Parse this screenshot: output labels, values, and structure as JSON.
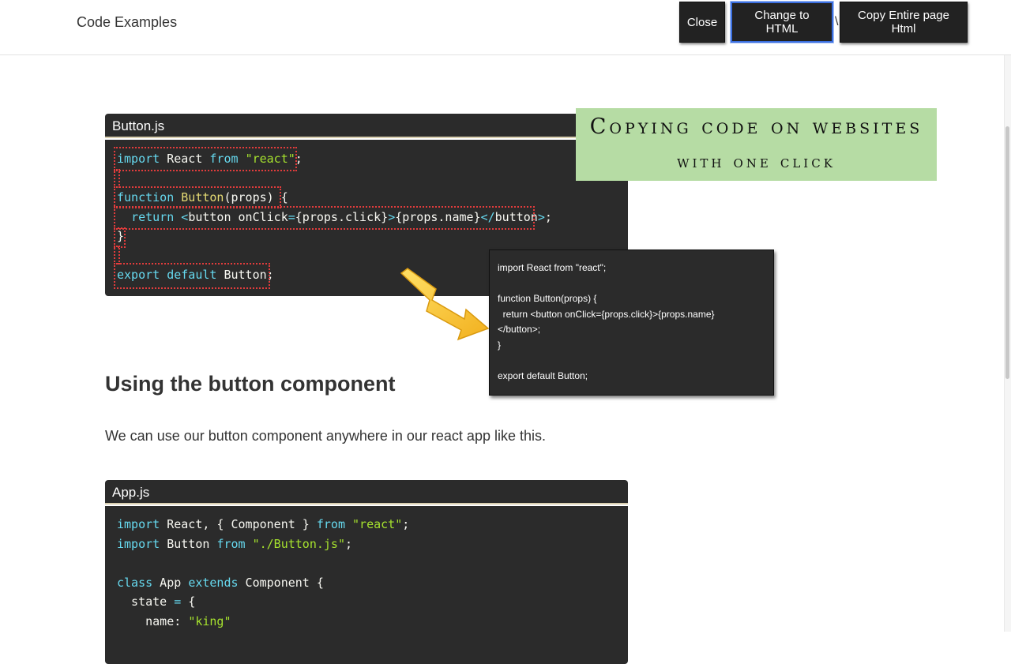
{
  "header": {
    "brand": "Code Examples",
    "buttons": {
      "close": "Close",
      "change_html": "Change to HTML",
      "copy_page": "Copy Entire page Html"
    },
    "separator": "\\"
  },
  "button_js": {
    "filename": "Button.js",
    "lines": [
      [
        {
          "t": "import",
          "c": "kw"
        },
        {
          "t": " React "
        },
        {
          "t": "from",
          "c": "kw"
        },
        {
          "t": " "
        },
        {
          "t": "\"react\"",
          "c": "str"
        },
        {
          "t": ";"
        }
      ],
      [],
      [
        {
          "t": "function",
          "c": "kw"
        },
        {
          "t": " "
        },
        {
          "t": "Button",
          "c": "fn"
        },
        {
          "t": "(props) {"
        }
      ],
      [
        {
          "t": "  "
        },
        {
          "t": "return",
          "c": "kw"
        },
        {
          "t": " "
        },
        {
          "t": "<",
          "c": "op"
        },
        {
          "t": "button onClick"
        },
        {
          "t": "=",
          "c": "op"
        },
        {
          "t": "{props.click}"
        },
        {
          "t": ">",
          "c": "op"
        },
        {
          "t": "{props.name}"
        },
        {
          "t": "</",
          "c": "op"
        },
        {
          "t": "button"
        },
        {
          "t": ">",
          "c": "op"
        },
        {
          "t": ";"
        }
      ],
      [
        {
          "t": "}"
        }
      ],
      [],
      [
        {
          "t": "export",
          "c": "kw"
        },
        {
          "t": " "
        },
        {
          "t": "default",
          "c": "kw"
        },
        {
          "t": " Button;"
        }
      ]
    ]
  },
  "banner": {
    "line1": "Copying code on websites",
    "line2": "with one click"
  },
  "popup": {
    "lines": [
      "import React from \"react\";",
      "",
      "function Button(props) {",
      "  return <button onClick={props.click}>{props.name}",
      "</button>;",
      "}",
      "",
      "export default Button;"
    ]
  },
  "article": {
    "heading": "Using the button component",
    "paragraph": "We can use our button component anywhere in our react app like this."
  },
  "app_js": {
    "filename": "App.js",
    "lines": [
      [
        {
          "t": "import",
          "c": "kw"
        },
        {
          "t": " React, { Component } "
        },
        {
          "t": "from",
          "c": "kw"
        },
        {
          "t": " "
        },
        {
          "t": "\"react\"",
          "c": "str"
        },
        {
          "t": ";"
        }
      ],
      [
        {
          "t": "import",
          "c": "kw"
        },
        {
          "t": " Button "
        },
        {
          "t": "from",
          "c": "kw"
        },
        {
          "t": " "
        },
        {
          "t": "\"./Button.js\"",
          "c": "str"
        },
        {
          "t": ";"
        }
      ],
      [],
      [
        {
          "t": "class",
          "c": "kw"
        },
        {
          "t": " App "
        },
        {
          "t": "extends",
          "c": "kw"
        },
        {
          "t": " Component {"
        }
      ],
      [
        {
          "t": "  state "
        },
        {
          "t": "=",
          "c": "op"
        },
        {
          "t": " {"
        }
      ],
      [
        {
          "t": "    name: "
        },
        {
          "t": "\"king\"",
          "c": "str"
        }
      ]
    ]
  }
}
